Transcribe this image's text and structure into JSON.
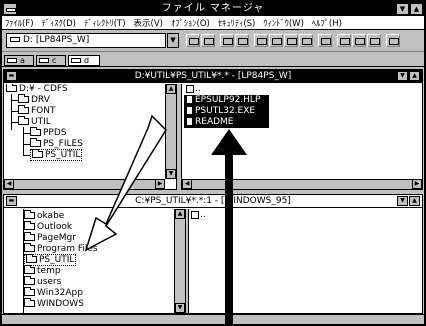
{
  "window": {
    "title": "ファイル マネージャ"
  },
  "menu": [
    {
      "label": "ﾌｧｲﾙ(F)"
    },
    {
      "label": "ﾃﾞｨｽｸ(D)"
    },
    {
      "label": "ﾃﾞｨﾚｸﾄﾘ(T)"
    },
    {
      "label": "表示(V)"
    },
    {
      "label": "ｵﾌﾟｼｮﾝ(O)"
    },
    {
      "label": "ｾｷｭﾘﾃｨ(S)"
    },
    {
      "label": "ｳｨﾝﾄﾞｳ(W)"
    },
    {
      "label": "ﾍﾙﾌﾟ(H)"
    }
  ],
  "toolbar": {
    "drive_select": "D: [LP84PS_W]"
  },
  "drives": [
    {
      "label": "a"
    },
    {
      "label": "c"
    },
    {
      "label": "d"
    }
  ],
  "top_window": {
    "title": "D:¥UTIL¥PS_UTIL¥*.* - [LP84PS_W]",
    "tree": {
      "root": "D:¥ - CDFS",
      "items": [
        {
          "label": "DRV"
        },
        {
          "label": "FONT"
        },
        {
          "label": "UTIL"
        },
        {
          "label": "PPDS"
        },
        {
          "label": "PS_FILES"
        },
        {
          "label": "PS_UTIL"
        }
      ]
    },
    "up_dir": "..",
    "files": [
      {
        "name": "EPSULP92.HLP"
      },
      {
        "name": "PSUTL32.EXE"
      },
      {
        "name": "README"
      }
    ]
  },
  "bottom_window": {
    "title": "C:¥PS_UTIL¥*.*:1 - [WINDOWS_95]",
    "tree": {
      "items": [
        {
          "label": "okabe"
        },
        {
          "label": "Outlook"
        },
        {
          "label": "PageMgr"
        },
        {
          "label": "Program Files"
        },
        {
          "label": "PS_UTIL"
        },
        {
          "label": "temp"
        },
        {
          "label": "users"
        },
        {
          "label": "Win32App"
        },
        {
          "label": "WINDOWS"
        }
      ]
    },
    "up_dir": ".."
  }
}
